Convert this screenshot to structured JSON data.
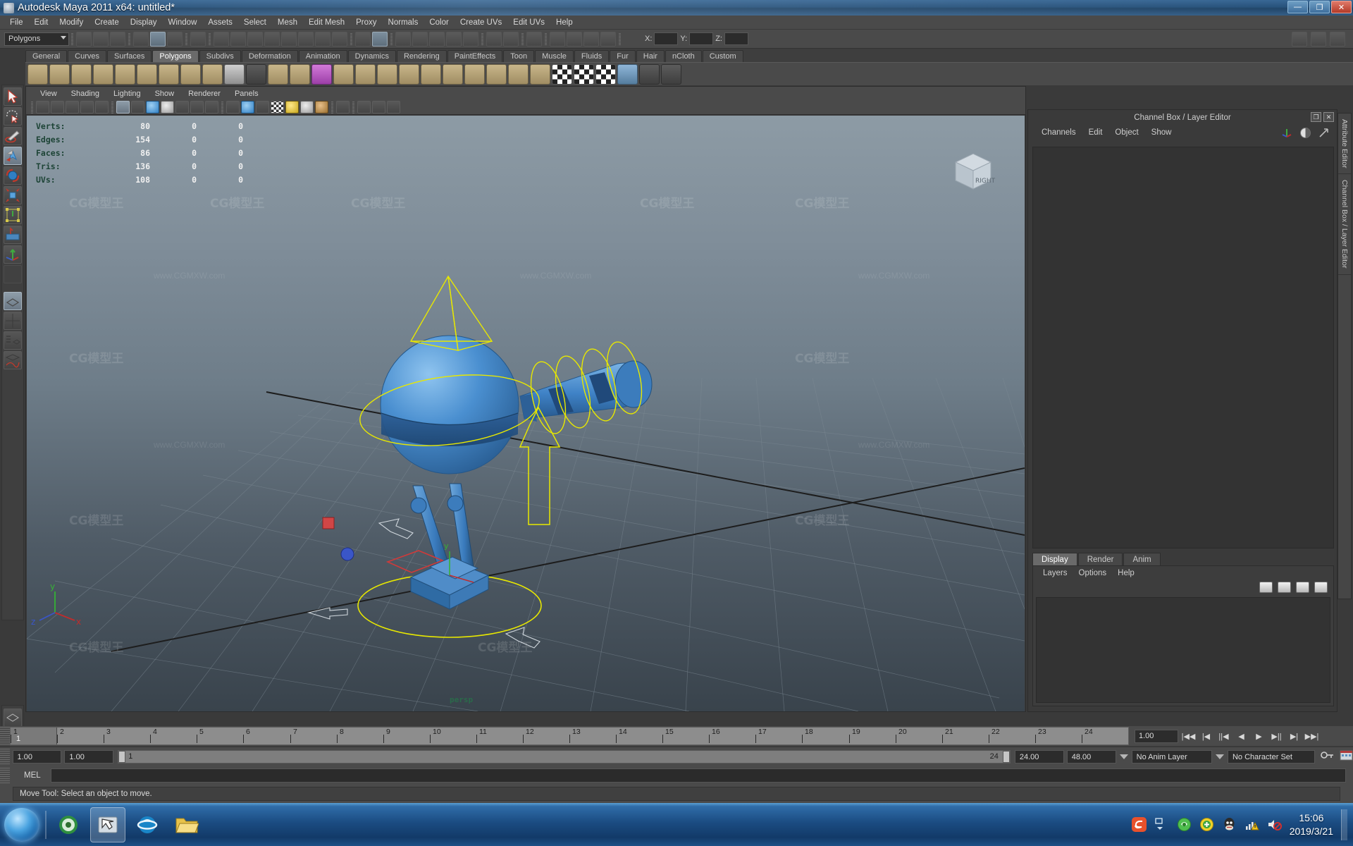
{
  "window": {
    "title": "Autodesk Maya 2011 x64: untitled*",
    "minimize": "—",
    "maximize": "❐",
    "close": "✕"
  },
  "menubar": {
    "items": [
      "File",
      "Edit",
      "Modify",
      "Create",
      "Display",
      "Window",
      "Assets",
      "Select",
      "Mesh",
      "Edit Mesh",
      "Proxy",
      "Normals",
      "Color",
      "Create UVs",
      "Edit UVs",
      "Help"
    ]
  },
  "statusline": {
    "menuset": "Polygons",
    "x_label": "X:",
    "y_label": "Y:",
    "z_label": "Z:",
    "x_value": "",
    "y_value": "",
    "z_value": ""
  },
  "shelf": {
    "tabs": [
      "General",
      "Curves",
      "Surfaces",
      "Polygons",
      "Subdivs",
      "Deformation",
      "Animation",
      "Dynamics",
      "Rendering",
      "PaintEffects",
      "Toon",
      "Muscle",
      "Fluids",
      "Fur",
      "Hair",
      "nCloth",
      "Custom"
    ],
    "active_tab": "Polygons"
  },
  "viewport": {
    "menu": [
      "View",
      "Shading",
      "Lighting",
      "Show",
      "Renderer",
      "Panels"
    ],
    "viewcube_face": "RIGHT",
    "hud": {
      "columns": 3,
      "rows": [
        {
          "label": "Verts:",
          "v1": "80",
          "v2": "0",
          "v3": "0"
        },
        {
          "label": "Edges:",
          "v1": "154",
          "v2": "0",
          "v3": "0"
        },
        {
          "label": "Faces:",
          "v1": "86",
          "v2": "0",
          "v3": "0"
        },
        {
          "label": "Tris:",
          "v1": "136",
          "v2": "0",
          "v3": "0"
        },
        {
          "label": "UVs:",
          "v1": "108",
          "v2": "0",
          "v3": "0"
        }
      ]
    },
    "axis_labels": {
      "x": "x",
      "y": "y",
      "z": "z"
    },
    "persp_label": "persp",
    "watermarks": [
      "CG模型王",
      "www.CGMXW.com"
    ]
  },
  "channelbox": {
    "title": "Channel Box / Layer Editor",
    "restore": "❐",
    "close": "✕",
    "menu": [
      "Channels",
      "Edit",
      "Object",
      "Show"
    ],
    "tabs": [
      "Display",
      "Render",
      "Anim"
    ],
    "active_tab": "Display",
    "layer_menu": [
      "Layers",
      "Options",
      "Help"
    ]
  },
  "attribute_editor_tabs": [
    "Attribute Editor",
    "Channel Box / Layer Editor"
  ],
  "timeline": {
    "ticks": [
      "1",
      "2",
      "3",
      "4",
      "5",
      "6",
      "7",
      "8",
      "9",
      "10",
      "11",
      "12",
      "13",
      "14",
      "15",
      "16",
      "17",
      "18",
      "19",
      "20",
      "21",
      "22",
      "23",
      "24"
    ],
    "current_frame": "1",
    "playback_speed": "1.00",
    "transport": [
      "|◀◀",
      "|◀",
      "||◀",
      "◀",
      "▶",
      "▶||",
      "▶|",
      "▶▶|"
    ]
  },
  "range": {
    "start": "1.00",
    "end": "1.00",
    "range_start": "1",
    "range_end": "24",
    "anim_start": "24.00",
    "anim_end": "48.00",
    "anim_layer": "No Anim Layer",
    "character_set": "No Character Set"
  },
  "command_line": {
    "label": "MEL",
    "value": "",
    "placeholder": ""
  },
  "help_line": {
    "text": "Move Tool: Select an object to move."
  },
  "taskbar": {
    "clock_time": "15:06",
    "clock_date": "2019/3/21",
    "apps": [
      "ie-browser",
      "maya-app",
      "explorer-folder"
    ],
    "tray": [
      "sogou-icon",
      "expand-icon",
      "shield-icon",
      "update-icon",
      "qq-icon",
      "network-icon",
      "volume-icon"
    ]
  },
  "colors": {
    "accent": "#6a6a6a",
    "panel": "#4a4a4a",
    "dark": "#333333",
    "hud_label": "#1d4436",
    "selection": "#ffff00",
    "model_blue": "#4a8fd0",
    "taskbar": "#1b4c82"
  }
}
